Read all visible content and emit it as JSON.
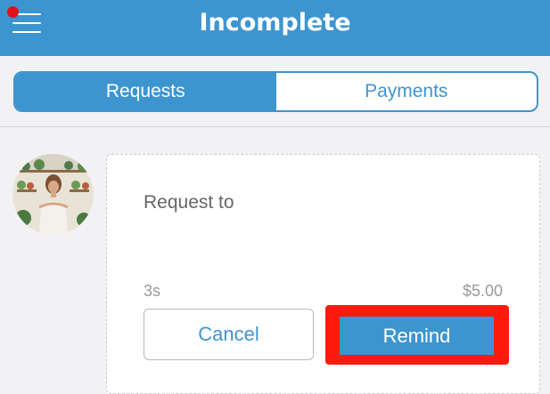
{
  "header": {
    "title": "Incomplete",
    "menu_icon": "hamburger-icon",
    "notification_color": "#e0101c",
    "background_color": "#3d95d0"
  },
  "tabs": [
    {
      "label": "Requests",
      "active": true
    },
    {
      "label": "Payments",
      "active": false
    }
  ],
  "request_card": {
    "title": "Request to",
    "time_ago": "3s",
    "amount": "$5.00",
    "cancel_label": "Cancel",
    "remind_label": "Remind",
    "highlight_color": "#ff1a0e"
  }
}
